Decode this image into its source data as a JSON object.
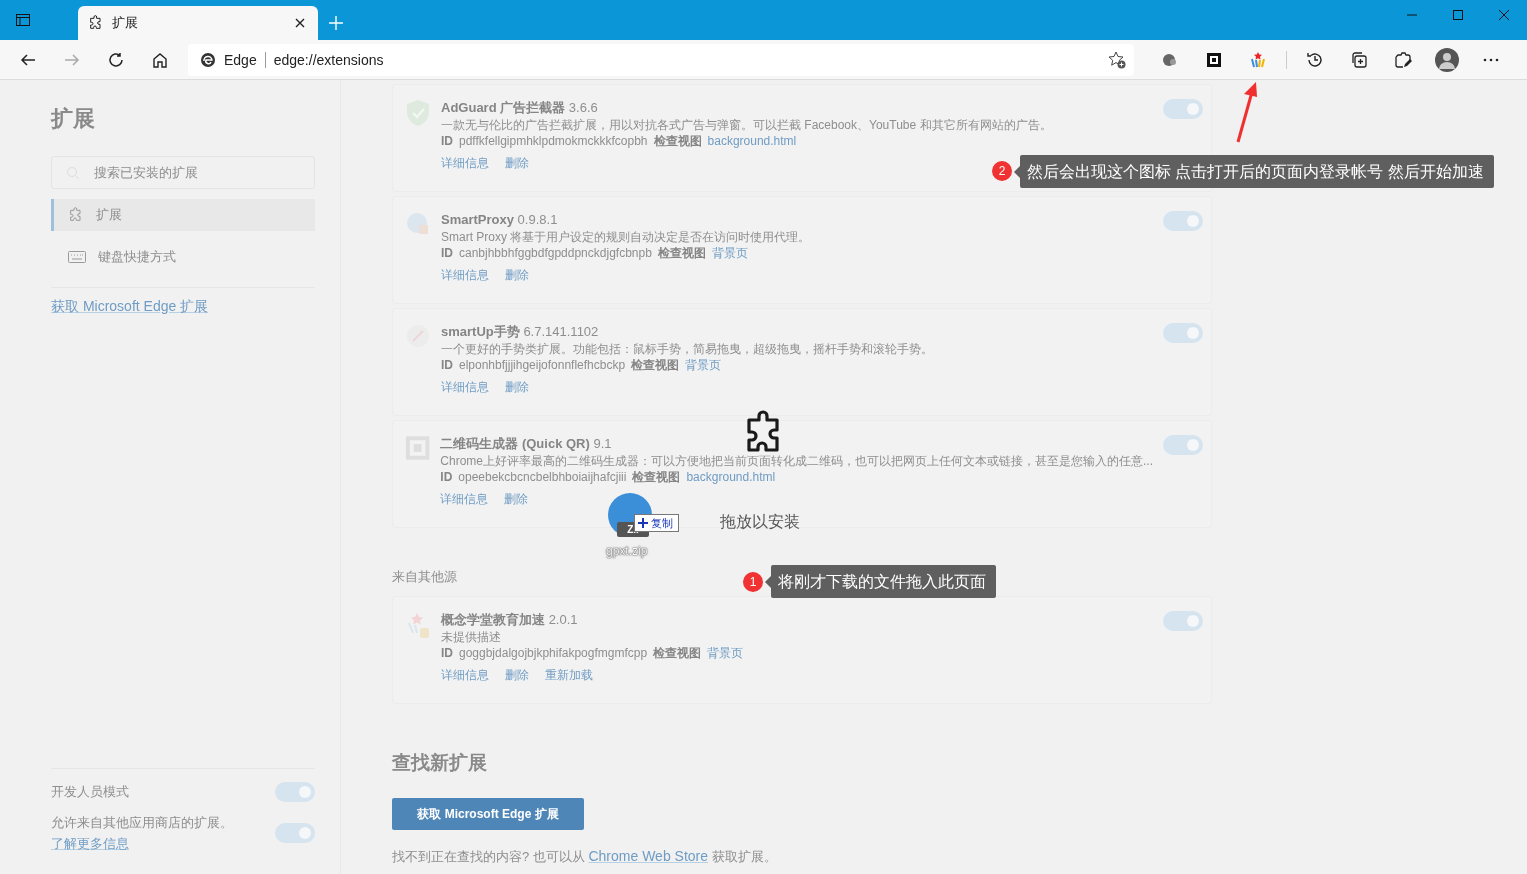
{
  "window": {
    "tab": {
      "title": "扩展"
    }
  },
  "toolbar": {
    "address": {
      "site_label": "Edge",
      "url": "edge://extensions"
    }
  },
  "sidebar": {
    "heading": "扩展",
    "search": {
      "placeholder": "搜索已安装的扩展"
    },
    "nav": [
      {
        "label": "扩展",
        "kind": "puzzle",
        "selected": true
      },
      {
        "label": "键盘快捷方式",
        "kind": "keyboard",
        "selected": false
      }
    ],
    "store_link": "获取 Microsoft Edge 扩展",
    "developer_mode": {
      "label": "开发人员模式",
      "on": true
    },
    "other_stores": {
      "text": "允许来自其他应用商店的扩展。",
      "link": "了解更多信息",
      "on": true
    }
  },
  "extensions": [
    {
      "kind": "shield",
      "name": "AdGuard 广告拦截器",
      "version": "3.6.6",
      "description": "一款无与伦比的广告拦截扩展，用以对抗各式广告与弹窗。可以拦截 Facebook、YouTube 和其它所有网站的广告。",
      "id_label": "ID",
      "id": "pdffkfellgipmhklpdmokmckkkfcopbh",
      "inspect_label": "检查视图",
      "inspect_link": "background.html",
      "actions": [
        "详细信息",
        "删除"
      ],
      "on": true
    },
    {
      "kind": "globe",
      "name": "SmartProxy",
      "version": "0.9.8.1",
      "description": "Smart Proxy 将基于用户设定的规则自动决定是否在访问时使用代理。",
      "id_label": "ID",
      "id": "canbjhbbhfggbdfgpddpnckdjgfcbnpb",
      "inspect_label": "检查视图",
      "inspect_link": "背景页",
      "actions": [
        "详细信息",
        "删除"
      ],
      "on": true
    },
    {
      "kind": "gesture",
      "name": "smartUp手势",
      "version": "6.7.141.1102",
      "description": "一个更好的手势类扩展。功能包括：鼠标手势，简易拖曳，超级拖曳，摇杆手势和滚轮手势。",
      "id_label": "ID",
      "id": "elponhbfjjjihgeijofonnflefhcbckp",
      "inspect_label": "检查视图",
      "inspect_link": "背景页",
      "actions": [
        "详细信息",
        "删除"
      ],
      "on": true
    },
    {
      "kind": "qr",
      "name": "二维码生成器 (Quick QR)",
      "version": "9.1",
      "description": "Chrome上好评率最高的二维码生成器：可以方便地把当前页面转化成二维码，也可以把网页上任何文本或链接，甚至是您输入的任意...",
      "id_label": "ID",
      "id": "opeebekcbcncbelbhboiaijhafcjiii",
      "inspect_label": "检查视图",
      "inspect_link": "background.html",
      "actions": [
        "详细信息",
        "删除"
      ],
      "on": true
    }
  ],
  "other_sources": {
    "heading": "来自其他源",
    "extensions": [
      {
        "kind": "stars",
        "name": "概念学堂教育加速",
        "version": "2.0.1",
        "description": "未提供描述",
        "id_label": "ID",
        "id": "goggbjdalgojbjkphifakpogfmgmfcpp",
        "inspect_label": "检查视图",
        "inspect_link": "背景页",
        "actions": [
          "详细信息",
          "删除",
          "重新加载"
        ],
        "on": true
      }
    ]
  },
  "find_new": {
    "heading": "查找新扩展",
    "button": "获取 Microsoft Edge 扩展",
    "text_before": "找不到正在查找的内容? 也可以从",
    "link": "Chrome Web Store",
    "text_after": "获取扩展。"
  },
  "drop_overlay": {
    "label": "拖放以安装",
    "file_name": "gpxt.zip",
    "file_badge": "Z..",
    "effect": "复制"
  },
  "callouts": [
    {
      "number": "1",
      "text": "将刚才下载的文件拖入此页面"
    },
    {
      "number": "2",
      "text": "然后会出现这个图标 点击打开后的页面内登录帐号 然后开始加速"
    }
  ]
}
